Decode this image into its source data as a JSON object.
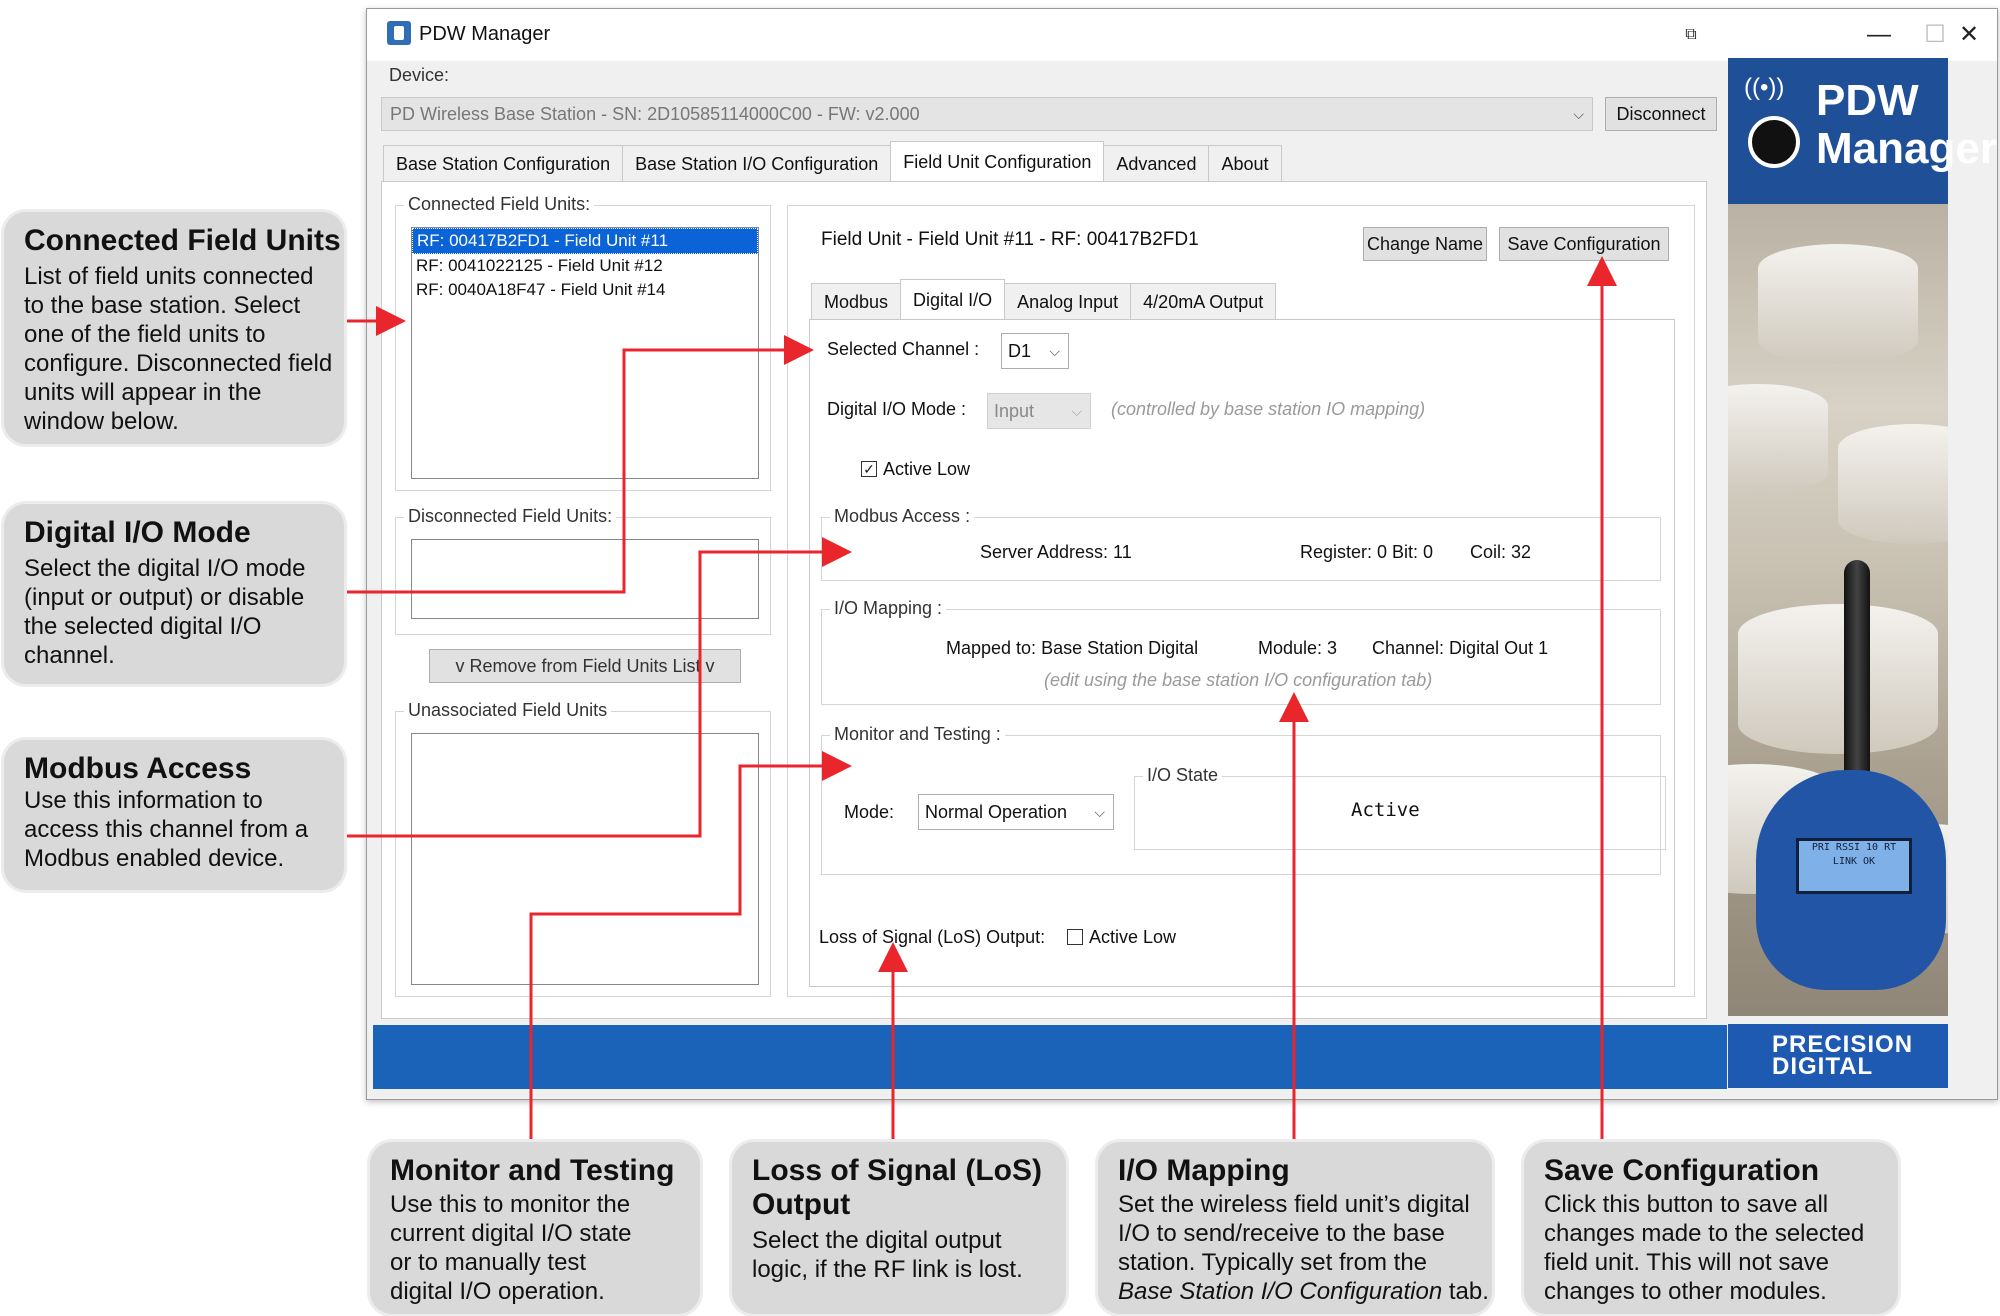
{
  "window": {
    "title": "PDW Manager",
    "controls": {
      "minimize": "—",
      "maximize": "☐",
      "close": "✕"
    }
  },
  "device": {
    "label": "Device:",
    "value": "PD Wireless Base Station - SN: 2D10585114000C00 - FW: v2.000",
    "disconnect_label": "Disconnect"
  },
  "main_tabs": [
    "Base Station Configuration",
    "Base Station I/O Configuration",
    "Field Unit Configuration",
    "Advanced",
    "About"
  ],
  "left": {
    "connected_title": "Connected Field Units:",
    "connected_items": [
      "RF: 00417B2FD1 - Field Unit #11",
      "RF: 0041022125 - Field Unit #12",
      "RF: 0040A18F47 - Field Unit #14"
    ],
    "disconnected_title": "Disconnected Field Units:",
    "remove_label": "v Remove from Field Units List v",
    "unassociated_title": "Unassociated Field Units"
  },
  "field_unit": {
    "header": "Field Unit - Field Unit #11 - RF: 00417B2FD1",
    "change_name_label": "Change Name",
    "save_label": "Save Configuration",
    "sub_tabs": [
      "Modbus",
      "Digital I/O",
      "Analog Input",
      "4/20mA Output"
    ],
    "selected_channel_label": "Selected Channel :",
    "selected_channel_value": "D1",
    "mode_label": "Digital I/O Mode :",
    "mode_value": "Input",
    "mode_hint": "(controlled by base station IO mapping)",
    "active_low_label": "Active Low",
    "modbus_title": "Modbus Access :",
    "server_address": "Server Address: 11",
    "register_bit": "Register: 0 Bit: 0",
    "coil": "Coil: 32",
    "mapping_title": "I/O Mapping :",
    "mapped_to": "Mapped to: Base Station Digital",
    "module": "Module: 3",
    "channel": "Channel: Digital Out 1",
    "mapping_hint": "(edit using the base station I/O configuration tab)",
    "monitor_title": "Monitor and Testing :",
    "mode2_label": "Mode:",
    "mode2_value": "Normal Operation",
    "io_state_title": "I/O State",
    "io_state_value": "Active",
    "los_label": "Loss of Signal (LoS) Output:",
    "los_active_low_label": "Active Low"
  },
  "brand": {
    "title_line1": "PDW",
    "title_line2": "Manager",
    "footer_line1": "PRECISION",
    "footer_line2": "DIGITAL",
    "device_screen_line1": "PRI RSSI 10 RT",
    "device_screen_line2": "LINK OK"
  },
  "callouts": {
    "connected": {
      "title": "Connected Field Units",
      "lines": [
        "List of field units connected",
        "to the base station. Select",
        "one of the field units to",
        "configure. Disconnected field",
        "units will appear in the",
        "window below."
      ]
    },
    "dio_mode": {
      "title": "Digital I/O Mode",
      "lines": [
        "Select the digital I/O mode",
        "(input or output) or disable",
        "the selected digital I/O",
        "channel."
      ]
    },
    "modbus": {
      "title": "Modbus Access",
      "lines": [
        "Use this information to",
        "access this channel from a",
        "Modbus enabled device."
      ]
    },
    "monitor": {
      "title": "Monitor and Testing",
      "lines": [
        "Use this to monitor the",
        "current digital I/O state",
        "or to manually test",
        "digital I/O operation."
      ]
    },
    "los": {
      "title_line1": "Loss of Signal (LoS)",
      "title_line2": "Output",
      "lines": [
        "Select the digital output",
        "logic, if the RF link is lost."
      ]
    },
    "mapping": {
      "title": "I/O Mapping",
      "lines": [
        "Set the wireless field unit’s digital",
        "I/O to send/receive to the base",
        "station. Typically set from the"
      ],
      "last_line_italic": "Base Station I/O Configuration",
      "last_line_end": " tab."
    },
    "save": {
      "title": "Save Configuration",
      "lines": [
        "Click this button to save all",
        "changes made to the selected",
        "field unit. This will not save",
        "changes to other modules."
      ]
    }
  },
  "colors": {
    "accent": "#1a63b8",
    "arrow": "#e8262b",
    "callout_bg": "#d9d9d9",
    "selection": "#0a64d8"
  }
}
